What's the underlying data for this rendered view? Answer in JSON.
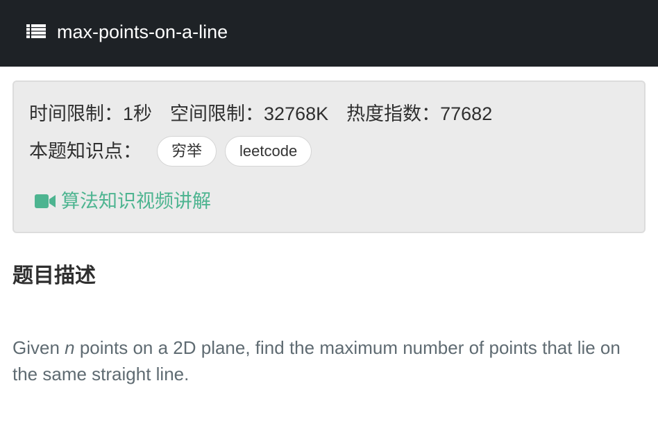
{
  "header": {
    "title": "max-points-on-a-line",
    "icon": "list-icon"
  },
  "info": {
    "time_limit": "时间限制：1秒",
    "space_limit": "空间限制：32768K",
    "popularity": "热度指数：77682",
    "knowledge_label": "本题知识点：",
    "tags": [
      "穷举",
      "leetcode"
    ],
    "video_link": "算法知识视频讲解",
    "video_icon": "video-camera-icon",
    "accent_color": "#4db490"
  },
  "problem": {
    "section_title": "题目描述",
    "desc_before": "Given ",
    "desc_var": "n",
    "desc_after": " points on a 2D plane, find the maximum number of points that lie on the same straight line."
  }
}
